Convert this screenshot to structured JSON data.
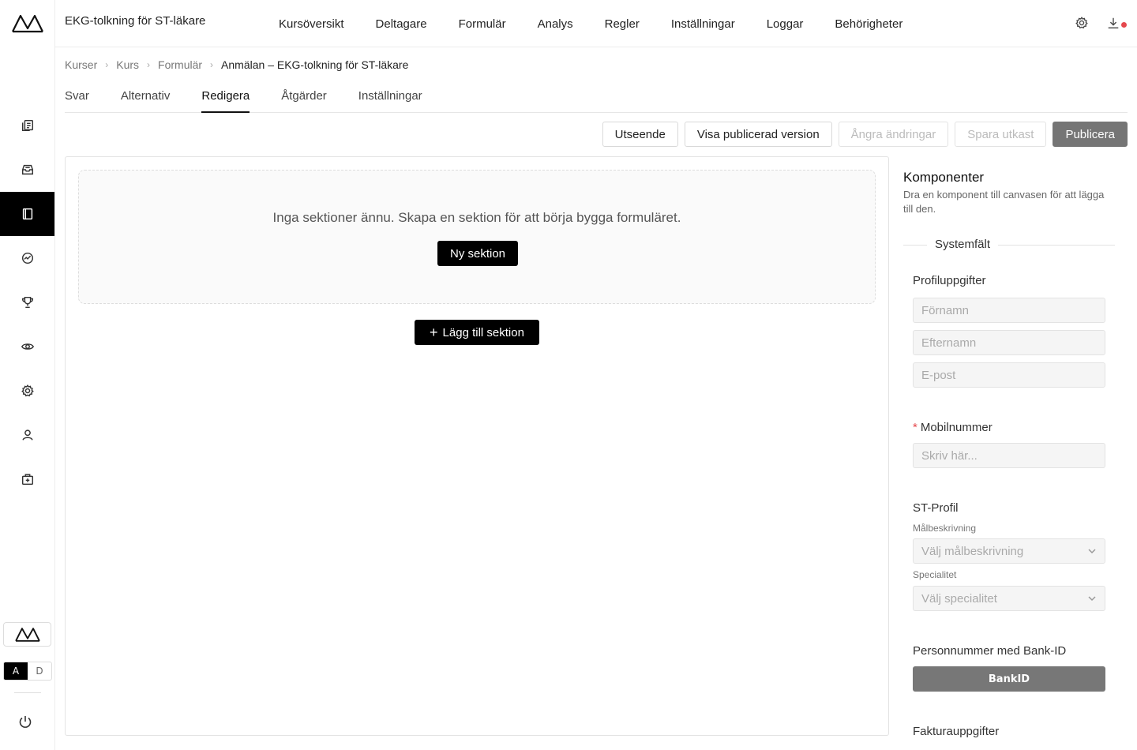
{
  "app": {
    "course_title": "EKG-tolkning för ST-läkare"
  },
  "topnav": {
    "items": [
      {
        "label": "Kursöversikt"
      },
      {
        "label": "Deltagare"
      },
      {
        "label": "Formulär"
      },
      {
        "label": "Analys"
      },
      {
        "label": "Regler"
      },
      {
        "label": "Inställningar"
      },
      {
        "label": "Loggar"
      },
      {
        "label": "Behörigheter"
      }
    ]
  },
  "breadcrumb": {
    "items": [
      "Kurser",
      "Kurs",
      "Formulär"
    ],
    "current": "Anmälan – EKG-tolkning för ST-läkare"
  },
  "tabs": {
    "items": [
      {
        "label": "Svar"
      },
      {
        "label": "Alternativ"
      },
      {
        "label": "Redigera",
        "active": true
      },
      {
        "label": "Åtgärder"
      },
      {
        "label": "Inställningar"
      }
    ]
  },
  "toolbar": {
    "appearance": "Utseende",
    "view_published": "Visa publicerad version",
    "undo_changes": "Ångra ändringar",
    "save_draft": "Spara utkast",
    "publish": "Publicera"
  },
  "canvas": {
    "empty_text": "Inga sektioner ännu. Skapa en sektion för att börja bygga formuläret.",
    "new_section": "Ny sektion",
    "add_section": "Lägg till sektion"
  },
  "panel": {
    "title": "Komponenter",
    "description": "Dra en komponent till canvasen för att lägga till den.",
    "system_fields": "Systemfält",
    "profile": {
      "title": "Profiluppgifter",
      "first_name": "Förnamn",
      "last_name": "Efternamn",
      "email": "E-post"
    },
    "mobile": {
      "title": "Mobilnummer",
      "required_mark": "*",
      "placeholder": "Skriv här..."
    },
    "st_profile": {
      "title": "ST-Profil",
      "goal_label": "Målbeskrivning",
      "goal_placeholder": "Välj målbeskrivning",
      "specialty_label": "Specialitet",
      "specialty_placeholder": "Välj specialitet"
    },
    "bankid": {
      "title": "Personnummer med Bank-ID",
      "button": "BankID"
    },
    "invoice": {
      "title": "Fakturauppgifter"
    }
  },
  "rail": {
    "toggle_a": "A",
    "toggle_d": "D",
    "active_item": "forms"
  },
  "colors": {
    "accent": "#000000",
    "publish_button": "#757575",
    "notification_dot": "#e5484d",
    "required": "#e5484d"
  }
}
